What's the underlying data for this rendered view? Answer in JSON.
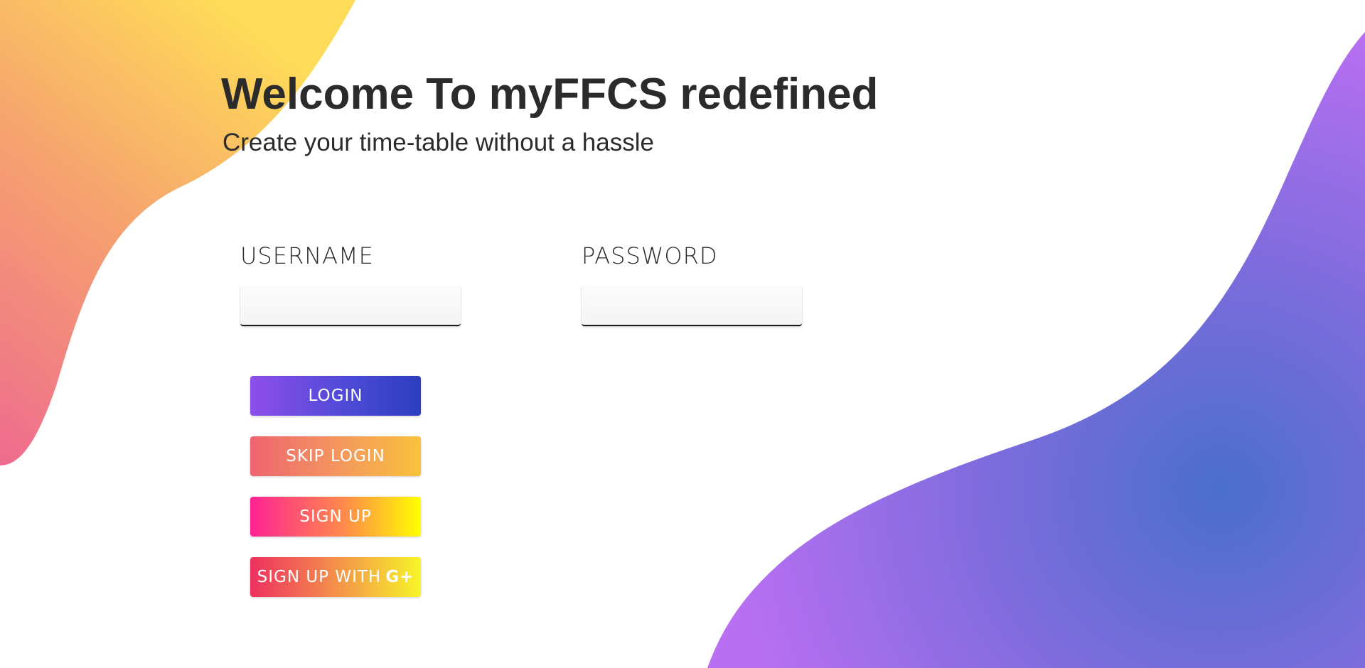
{
  "header": {
    "title": "Welcome To myFFCS redefined",
    "subtitle": "Create your time-table without a hassle"
  },
  "form": {
    "username_label": "USERNAME",
    "username_value": "",
    "password_label": "PASSWORD",
    "password_value": ""
  },
  "buttons": {
    "login": "LOGIN",
    "skip_login": "SKIP LOGIN",
    "sign_up": "SIGN UP",
    "sign_up_google": "SIGN UP WITH",
    "google_icon_glyph": "G+"
  },
  "colors": {
    "text": "#2b2b2b",
    "blob_left_top": "#fdd65a",
    "blob_left_bottom": "#ef6b8c",
    "blob_right_start": "#b36ef0",
    "blob_right_end": "#4a6fd0"
  },
  "icons": {
    "google_plus": "google-plus-icon"
  }
}
